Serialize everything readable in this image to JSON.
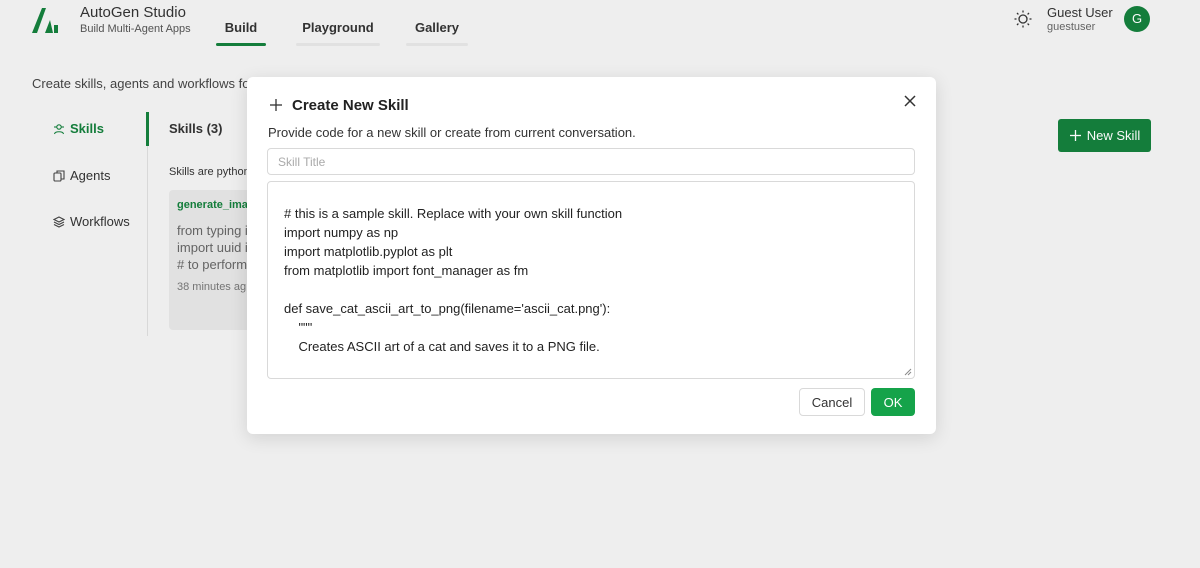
{
  "header": {
    "app_title": "AutoGen Studio",
    "app_subtitle": "Build Multi-Agent Apps",
    "tabs": [
      {
        "label": "Build",
        "active": true
      },
      {
        "label": "Playground",
        "active": false
      },
      {
        "label": "Gallery",
        "active": false
      }
    ],
    "user_name": "Guest User",
    "user_handle": "guestuser",
    "avatar_initial": "G",
    "theme_icon": "sun-icon"
  },
  "page": {
    "description": "Create skills, agents and workflows for",
    "sidebar": [
      {
        "label": "Skills",
        "icon": "skills-icon",
        "active": true
      },
      {
        "label": "Agents",
        "icon": "agents-icon",
        "active": false
      },
      {
        "label": "Workflows",
        "icon": "workflows-icon",
        "active": false
      }
    ],
    "skills_heading": "Skills (3)",
    "skills_subtitle": "Skills are python",
    "new_skill_label": "New Skill",
    "card": {
      "title": "generate_ima",
      "lines": [
        "from typing i",
        "import uuid i",
        "# to perform"
      ],
      "time": "38 minutes ag"
    }
  },
  "modal": {
    "title": "Create New Skill",
    "description": "Provide code for a new skill or create from current conversation.",
    "title_placeholder": "Skill Title",
    "code_lines": [
      "",
      "# this is a sample skill. Replace with your own skill function",
      "import numpy as np",
      "import matplotlib.pyplot as plt",
      "from matplotlib import font_manager as fm",
      "",
      "def save_cat_ascii_art_to_png(filename='ascii_cat.png'):",
      "    \"\"\"",
      "    Creates ASCII art of a cat and saves it to a PNG file."
    ],
    "cancel_label": "Cancel",
    "ok_label": "OK"
  },
  "colors": {
    "accent": "#15803d",
    "ok_button": "#15a34a"
  }
}
